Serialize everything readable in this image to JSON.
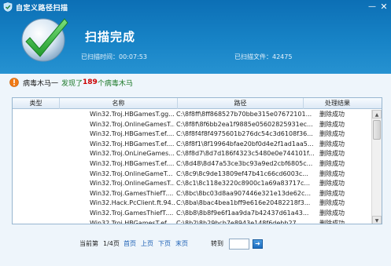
{
  "window": {
    "title": "自定义路径扫描",
    "minimize_glyph": "—",
    "close_glyph": "✕"
  },
  "header": {
    "status_title": "扫描完成",
    "time_label": "已扫描时间：00:07:53",
    "files_label": "已扫描文件：42475"
  },
  "alert": {
    "prefix": "病毒木马一",
    "found_before": "发现了",
    "count": "189",
    "found_after": "个病毒木马"
  },
  "table": {
    "columns": [
      "类型",
      "名称",
      "路径",
      "处理结果"
    ],
    "rows": [
      {
        "type": "病毒",
        "name": "Win32.Troj.HBGamesT.gg....",
        "path": "C:\\8f8ff\\8ff868527b70bbe315e07672101...",
        "result": "删除成功"
      },
      {
        "type": "病毒",
        "name": "Win32.Troj.OnlineGamesT...",
        "path": "C:\\8f8f\\8f6bb2ea1f9885e05602825931ec...",
        "result": "删除成功"
      },
      {
        "type": "病毒",
        "name": "Win32.Troj.HBGamesT.ef....",
        "path": "C:\\8f8f4f8f4975601b276dc54c3d6108f36...",
        "result": "删除成功"
      },
      {
        "type": "病毒",
        "name": "Win32.Troj.HBGamesT.ef....",
        "path": "C:\\8f8f1\\8f19964bfae20bf0d4e2f1ad1aa5...",
        "result": "删除成功"
      },
      {
        "type": "病毒",
        "name": "Win32.Troj.OnLineGames...",
        "path": "C:\\8f8d7\\8d7d186f4323c5480e0e744101f...",
        "result": "删除成功"
      },
      {
        "type": "病毒",
        "name": "Win32.Troj.HBGamesT.ef....",
        "path": "C:\\8d48\\8d47a53ce3bc93a9ed2cbf6805c...",
        "result": "删除成功"
      },
      {
        "type": "病毒",
        "name": "Win32.Troj.OnlineGameT...",
        "path": "C:\\8c9\\8c9de13809ef47b41c66cd6003c...",
        "result": "删除成功"
      },
      {
        "type": "病毒",
        "name": "Win32.Troj.OnlineGamesT...",
        "path": "C:\\8c1\\8c118e3220c8900c1a69a83717c...",
        "result": "删除成功"
      },
      {
        "type": "病毒",
        "name": "Win32.Troj.GamesThiefT....",
        "path": "C:\\8bc\\8bc03d8aa907446e321e13de62c...",
        "result": "删除成功"
      },
      {
        "type": "病毒",
        "name": "Win32.Hack.PcClient.ft.94...",
        "path": "C:\\8ba\\8bac4bea1bff9e616e20482218f3...",
        "result": "删除成功"
      },
      {
        "type": "病毒",
        "name": "Win32.Troj.GamesThiefT....",
        "path": "C:\\8b8\\8b8f9e6f1aa9da7b42437d61a43...",
        "result": "删除成功"
      },
      {
        "type": "病毒",
        "name": "Win32.Troj.HBGamesT.ef....",
        "path": "C:\\8b2\\8b29bcb7e8943e148f6debb27...",
        "result": "删除成功"
      }
    ],
    "type_icon": "virus-bug-icon"
  },
  "pager": {
    "current_label": "当前第",
    "page_info": "1/4页",
    "first": "首页",
    "prev": "上页",
    "next": "下页",
    "last": "末页",
    "goto_label": "转到",
    "goto_value": "",
    "goto_button_glyph": "➜"
  },
  "colors": {
    "header_blue": "#1783c6",
    "alert_count": "#cc0000",
    "link": "#1a5fb4",
    "check_green": "#3cb43c"
  }
}
